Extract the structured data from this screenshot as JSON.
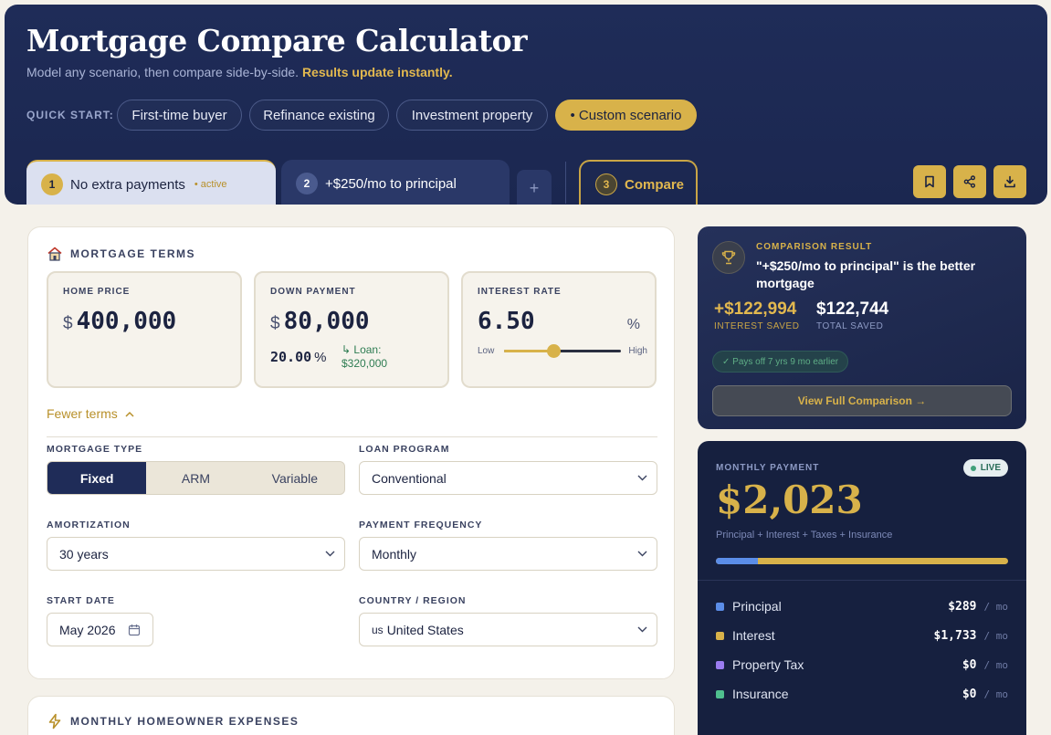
{
  "header": {
    "title": "Mortgage Compare Calculator",
    "subtitle": "Model any scenario, then compare side-by-side.",
    "subtitle_highlight": "Results update instantly.",
    "quick_start_label": "QUICK START:",
    "quick_start_chips": [
      "First-time buyer",
      "Refinance existing",
      "Investment property",
      "• Custom scenario"
    ]
  },
  "tabs": [
    {
      "num": "1",
      "label": "No extra payments",
      "badge": "• active"
    },
    {
      "num": "2",
      "label": "+$250/mo to principal"
    },
    {
      "num": "3",
      "label": "Compare"
    }
  ],
  "add_tab_label": "+",
  "icons": {
    "actions": [
      "bookmark-icon",
      "share-icon",
      "download-icon"
    ],
    "accent": "#d8b24a",
    "navy": "#1f2c58"
  },
  "terms": {
    "section_title": "MORTGAGE TERMS",
    "home_price": {
      "label": "HOME PRICE",
      "currency": "$",
      "value": "400,000"
    },
    "down_payment": {
      "label": "DOWN PAYMENT",
      "currency": "$",
      "value": "80,000",
      "percent": "20.00",
      "percent_sign": "%",
      "loan_note_prefix": "↳ Loan:",
      "loan_note_value": "$320,000"
    },
    "interest_rate": {
      "label": "INTEREST RATE",
      "value": "6.50",
      "unit": "%",
      "low": "Low",
      "high": "High",
      "slider_fraction": 0.42
    },
    "fewer_label": "Fewer terms"
  },
  "fields": {
    "mortgage_type": {
      "label": "MORTGAGE TYPE",
      "options": [
        "Fixed",
        "ARM",
        "Variable"
      ],
      "selected": "Fixed"
    },
    "loan_program": {
      "label": "LOAN PROGRAM",
      "value": "Conventional"
    },
    "amortization": {
      "label": "AMORTIZATION",
      "value": "30 years"
    },
    "payment_frequency": {
      "label": "PAYMENT FREQUENCY",
      "value": "Monthly"
    },
    "start_date": {
      "label": "START DATE",
      "value": "May 2026"
    },
    "country": {
      "label": "COUNTRY / REGION",
      "flag": "us",
      "value": "United States"
    }
  },
  "expenses": {
    "section_title": "MONTHLY HOMEOWNER EXPENSES"
  },
  "result": {
    "label": "COMPARISON RESULT",
    "title": "\"+$250/mo to principal\" is the better mortgage",
    "interest_saved": {
      "value": "+$122,994",
      "label": "INTEREST SAVED"
    },
    "total_saved": {
      "value": "$122,744",
      "label": "TOTAL SAVED"
    },
    "pill": "✓ Pays off 7 yrs 9 mo earlier",
    "button": "View Full Comparison →"
  },
  "payment": {
    "label": "MONTHLY PAYMENT",
    "live": "LIVE",
    "amount": "$2,023",
    "note": "Principal + Interest + Taxes + Insurance",
    "principal_fraction": 0.143,
    "per": "/ mo",
    "breakdown": [
      {
        "name": "Principal",
        "value": "$289",
        "color": "#5b8de8"
      },
      {
        "name": "Interest",
        "value": "$1,733",
        "color": "#d8b24a"
      },
      {
        "name": "Property Tax",
        "value": "$0",
        "color": "#9a7cf0"
      },
      {
        "name": "Insurance",
        "value": "$0",
        "color": "#4fbf8e"
      }
    ]
  }
}
